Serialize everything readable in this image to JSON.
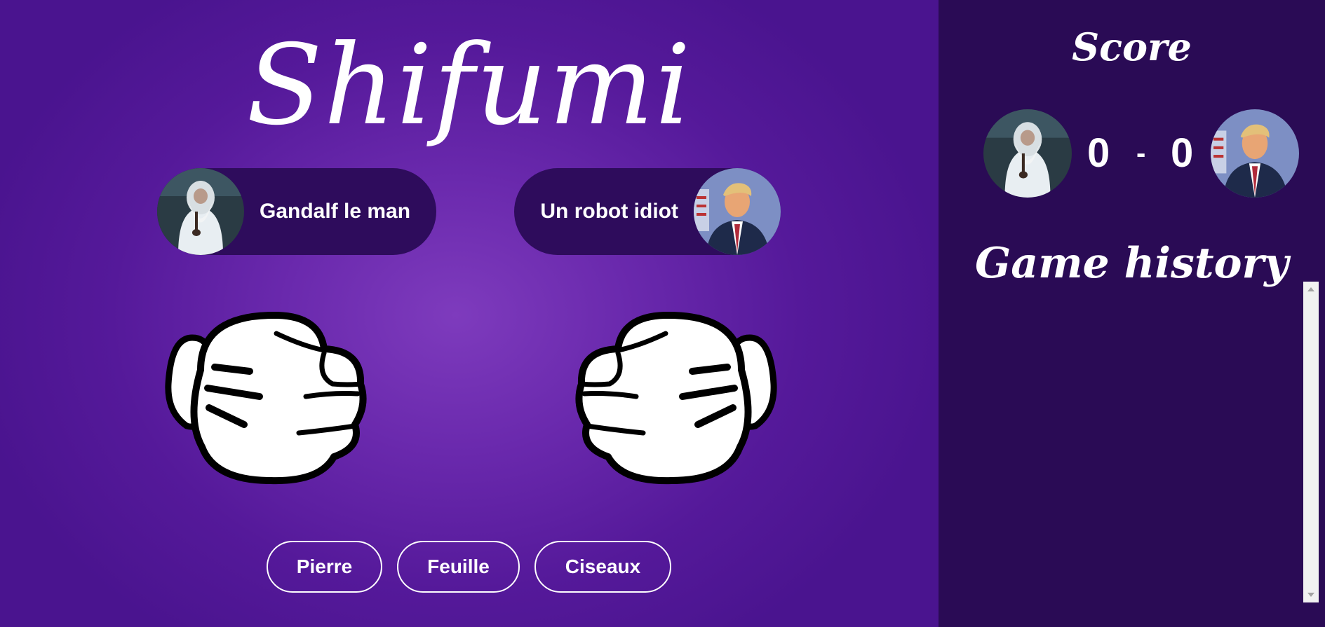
{
  "game": {
    "title": "Shifumi"
  },
  "players": {
    "player1": {
      "name": "Gandalf le man",
      "avatar_icon": "gandalf-avatar-icon"
    },
    "player2": {
      "name": "Un robot idiot",
      "avatar_icon": "trump-avatar-icon"
    }
  },
  "hands": {
    "left_icon": "fist-icon",
    "right_icon": "fist-icon"
  },
  "choices": {
    "rock_label": "Pierre",
    "paper_label": "Feuille",
    "scissors_label": "Ciseaux"
  },
  "score": {
    "title": "Score",
    "player1": "0",
    "separator": "-",
    "player2": "0"
  },
  "history": {
    "title": "Game history",
    "entries": []
  },
  "colors": {
    "background_center": "#7e3bbd",
    "background_edge": "#4a148f",
    "panel": "#2a0b55",
    "pill": "#2e0c5c",
    "text": "#ffffff"
  }
}
